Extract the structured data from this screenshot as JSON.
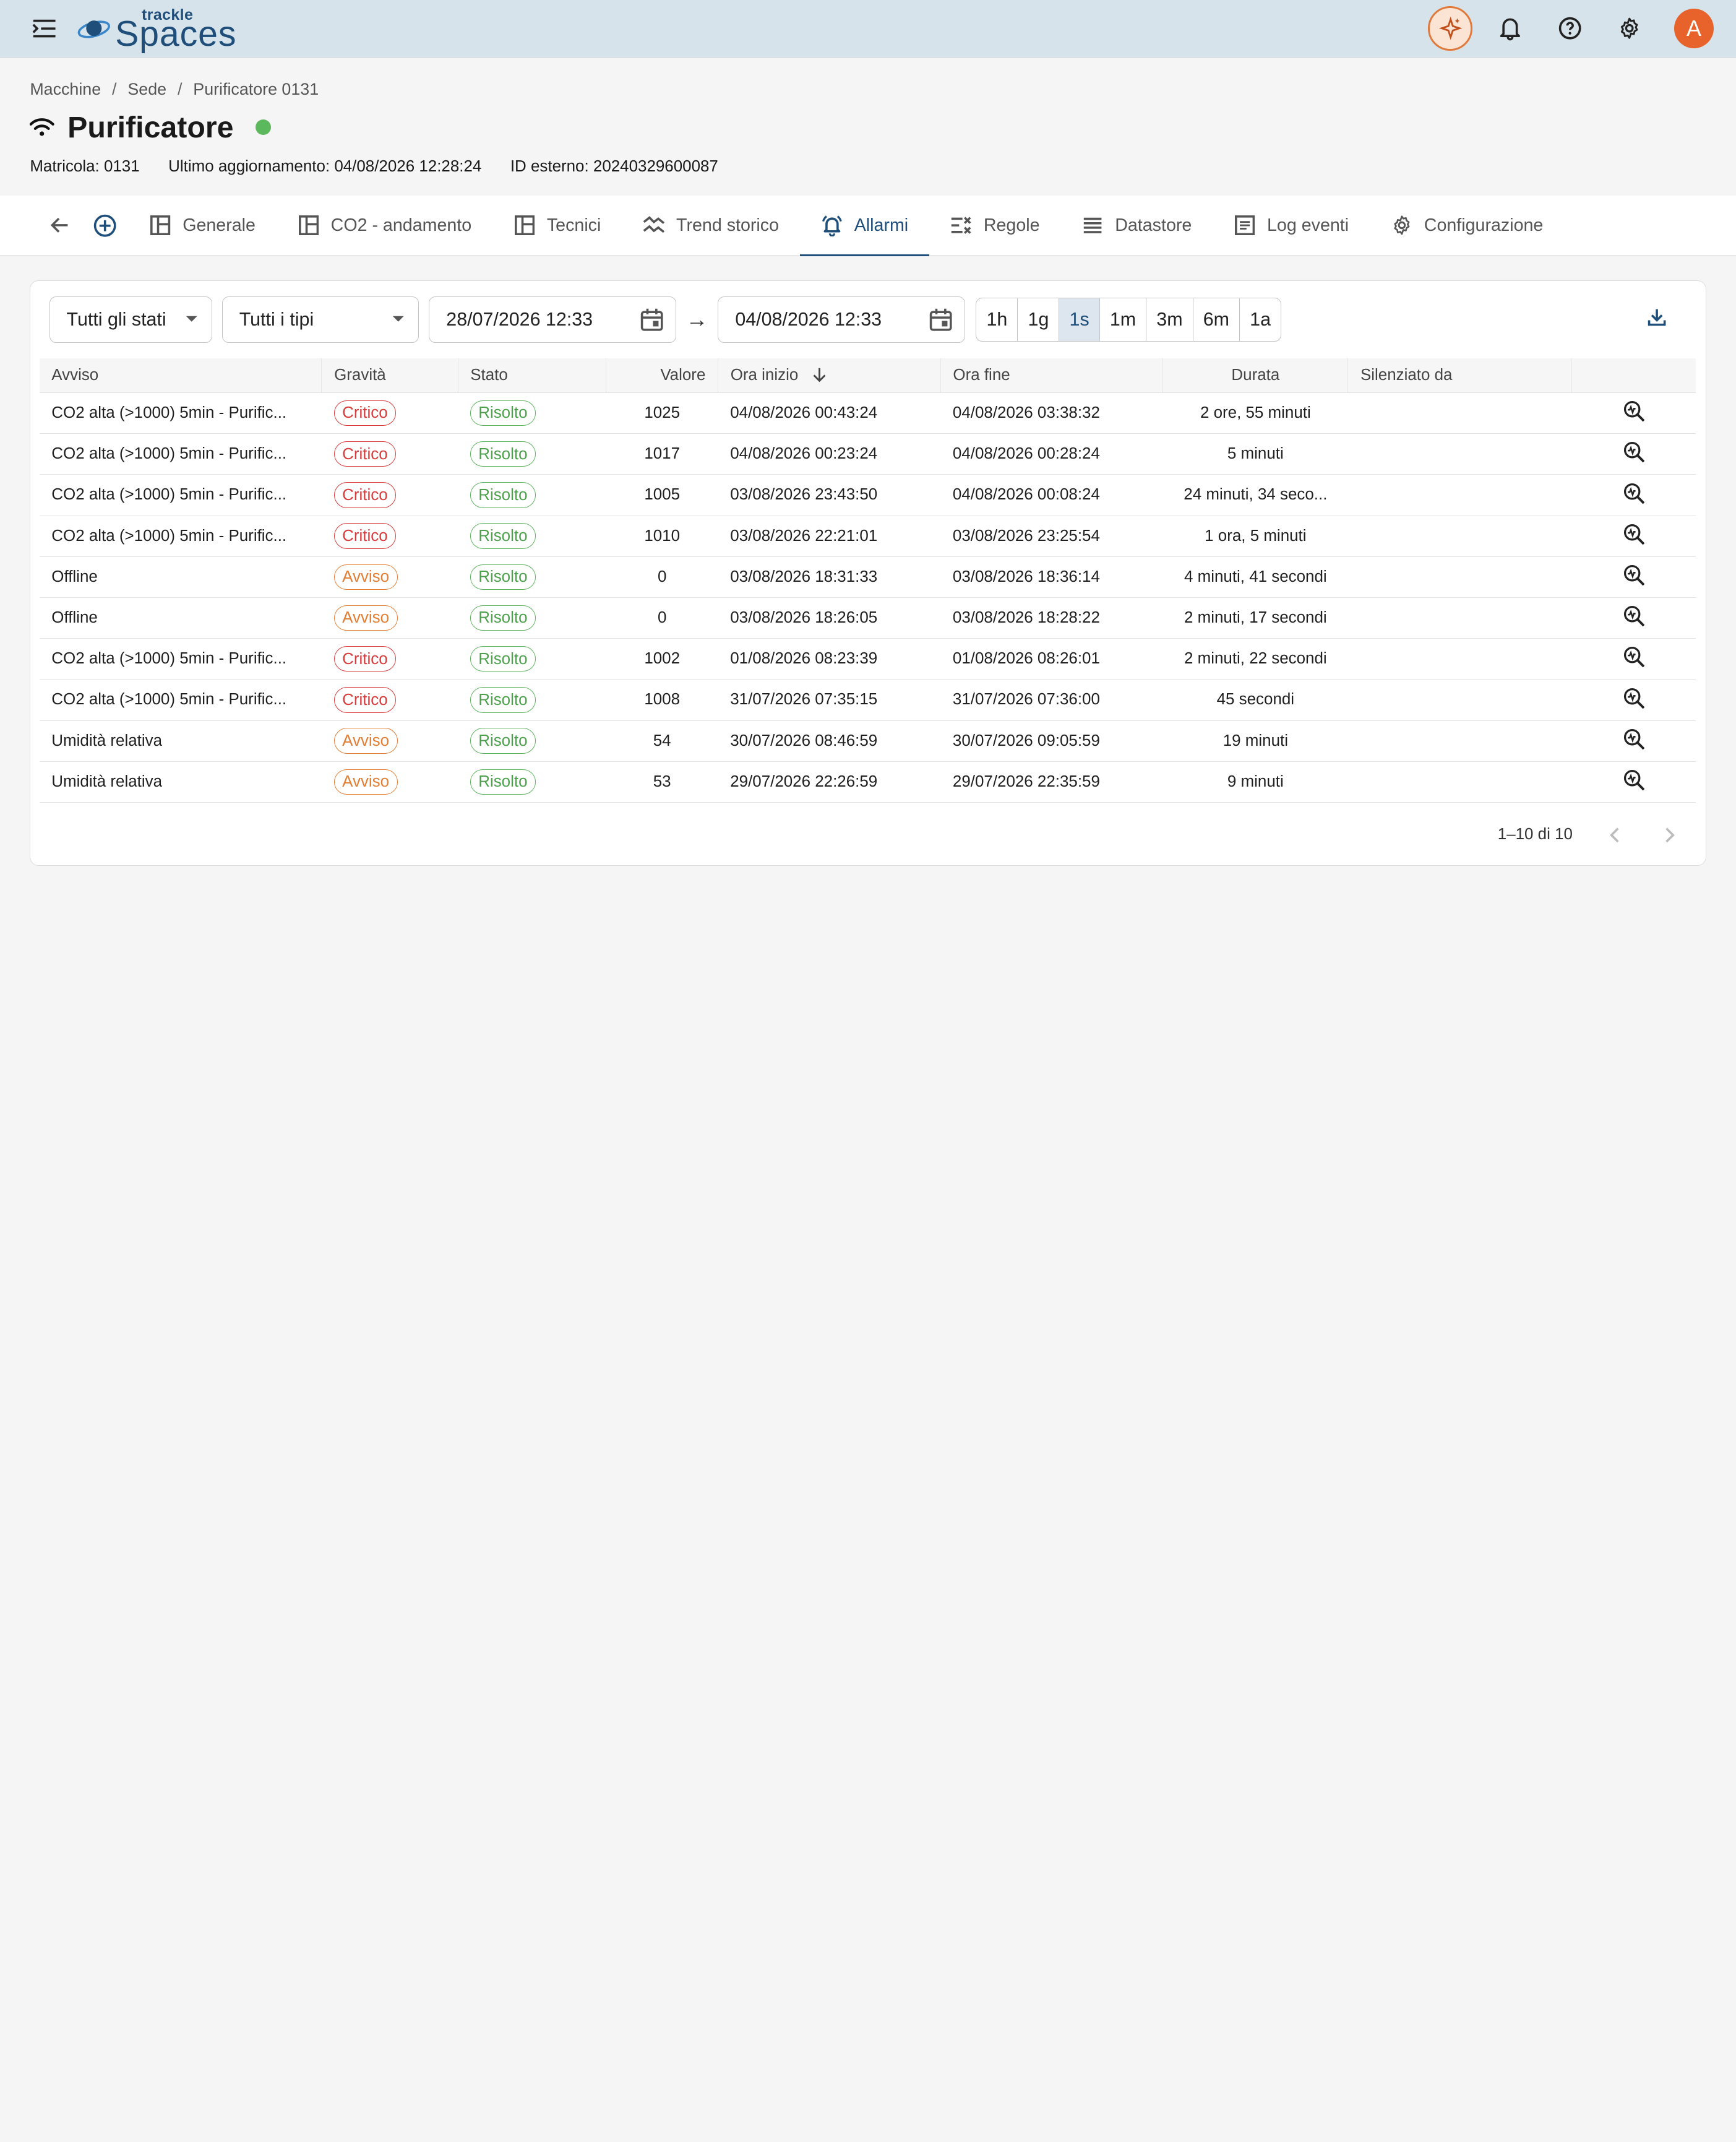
{
  "app": {
    "logo_small": "trackle",
    "logo_big": "Spaces",
    "avatar_letter": "A"
  },
  "breadcrumb": [
    "Macchine",
    "Sede",
    "Purificatore 0131"
  ],
  "page": {
    "title": "Purificatore",
    "status_color": "#5cb85c",
    "meta": {
      "matricola": "Matricola: 0131",
      "last_update": "Ultimo aggiornamento: 04/08/2026 12:28:24",
      "external_id": "ID esterno: 20240329600087"
    }
  },
  "tabs": [
    {
      "label": "Generale",
      "icon": "dashboard-icon"
    },
    {
      "label": "CO2 - andamento",
      "icon": "dashboard-icon"
    },
    {
      "label": "Tecnici",
      "icon": "dashboard-icon"
    },
    {
      "label": "Trend storico",
      "icon": "trend-icon"
    },
    {
      "label": "Allarmi",
      "icon": "alarm-bell-icon",
      "active": true
    },
    {
      "label": "Regole",
      "icon": "rules-icon"
    },
    {
      "label": "Datastore",
      "icon": "list-icon"
    },
    {
      "label": "Log eventi",
      "icon": "log-icon"
    },
    {
      "label": "Configurazione",
      "icon": "gear-icon"
    }
  ],
  "filters": {
    "state": "Tutti gli stati",
    "type": "Tutti i tipi",
    "date_from": "28/07/2026 12:33",
    "arrow": "→",
    "date_to": "04/08/2026 12:33",
    "ranges": [
      "1h",
      "1g",
      "1s",
      "1m",
      "3m",
      "6m",
      "1a"
    ],
    "active_range": "1s"
  },
  "table": {
    "columns": {
      "avviso": "Avviso",
      "gravita": "Gravità",
      "stato": "Stato",
      "valore": "Valore",
      "ora_inizio": "Ora inizio",
      "ora_fine": "Ora fine",
      "durata": "Durata",
      "silenziato": "Silenziato da"
    },
    "rows": [
      {
        "avviso": "CO2 alta (>1000) 5min - Purific...",
        "gravita": "Critico",
        "severity": "critical",
        "stato": "Risolto",
        "valore": "1025",
        "inizio": "04/08/2026 00:43:24",
        "fine": "04/08/2026 03:38:32",
        "durata": "2 ore, 55 minuti",
        "silenziato": ""
      },
      {
        "avviso": "CO2 alta (>1000) 5min - Purific...",
        "gravita": "Critico",
        "severity": "critical",
        "stato": "Risolto",
        "valore": "1017",
        "inizio": "04/08/2026 00:23:24",
        "fine": "04/08/2026 00:28:24",
        "durata": "5 minuti",
        "silenziato": ""
      },
      {
        "avviso": "CO2 alta (>1000) 5min - Purific...",
        "gravita": "Critico",
        "severity": "critical",
        "stato": "Risolto",
        "valore": "1005",
        "inizio": "03/08/2026 23:43:50",
        "fine": "04/08/2026 00:08:24",
        "durata": "24 minuti, 34 seco...",
        "silenziato": ""
      },
      {
        "avviso": "CO2 alta (>1000) 5min - Purific...",
        "gravita": "Critico",
        "severity": "critical",
        "stato": "Risolto",
        "valore": "1010",
        "inizio": "03/08/2026 22:21:01",
        "fine": "03/08/2026 23:25:54",
        "durata": "1 ora, 5 minuti",
        "silenziato": ""
      },
      {
        "avviso": "Offline",
        "gravita": "Avviso",
        "severity": "warning",
        "stato": "Risolto",
        "valore": "0",
        "inizio": "03/08/2026 18:31:33",
        "fine": "03/08/2026 18:36:14",
        "durata": "4 minuti, 41 secondi",
        "silenziato": ""
      },
      {
        "avviso": "Offline",
        "gravita": "Avviso",
        "severity": "warning",
        "stato": "Risolto",
        "valore": "0",
        "inizio": "03/08/2026 18:26:05",
        "fine": "03/08/2026 18:28:22",
        "durata": "2 minuti, 17 secondi",
        "silenziato": ""
      },
      {
        "avviso": "CO2 alta (>1000) 5min - Purific...",
        "gravita": "Critico",
        "severity": "critical",
        "stato": "Risolto",
        "valore": "1002",
        "inizio": "01/08/2026 08:23:39",
        "fine": "01/08/2026 08:26:01",
        "durata": "2 minuti, 22 secondi",
        "silenziato": ""
      },
      {
        "avviso": "CO2 alta (>1000) 5min - Purific...",
        "gravita": "Critico",
        "severity": "critical",
        "stato": "Risolto",
        "valore": "1008",
        "inizio": "31/07/2026 07:35:15",
        "fine": "31/07/2026 07:36:00",
        "durata": "45 secondi",
        "silenziato": ""
      },
      {
        "avviso": "Umidità relativa",
        "gravita": "Avviso",
        "severity": "warning",
        "stato": "Risolto",
        "valore": "54",
        "inizio": "30/07/2026 08:46:59",
        "fine": "30/07/2026 09:05:59",
        "durata": "19 minuti",
        "silenziato": ""
      },
      {
        "avviso": "Umidità relativa",
        "gravita": "Avviso",
        "severity": "warning",
        "stato": "Risolto",
        "valore": "53",
        "inizio": "29/07/2026 22:26:59",
        "fine": "29/07/2026 22:35:59",
        "durata": "9 minuti",
        "silenziato": ""
      }
    ]
  },
  "pagination": {
    "label": "1–10 di 10"
  },
  "colors": {
    "primary": "#1e4e79",
    "critical": "#d93b3b",
    "warning": "#e37e34",
    "resolved": "#4aa14a",
    "topbar": "#d7e3ea",
    "avatar": "#e8632b"
  }
}
